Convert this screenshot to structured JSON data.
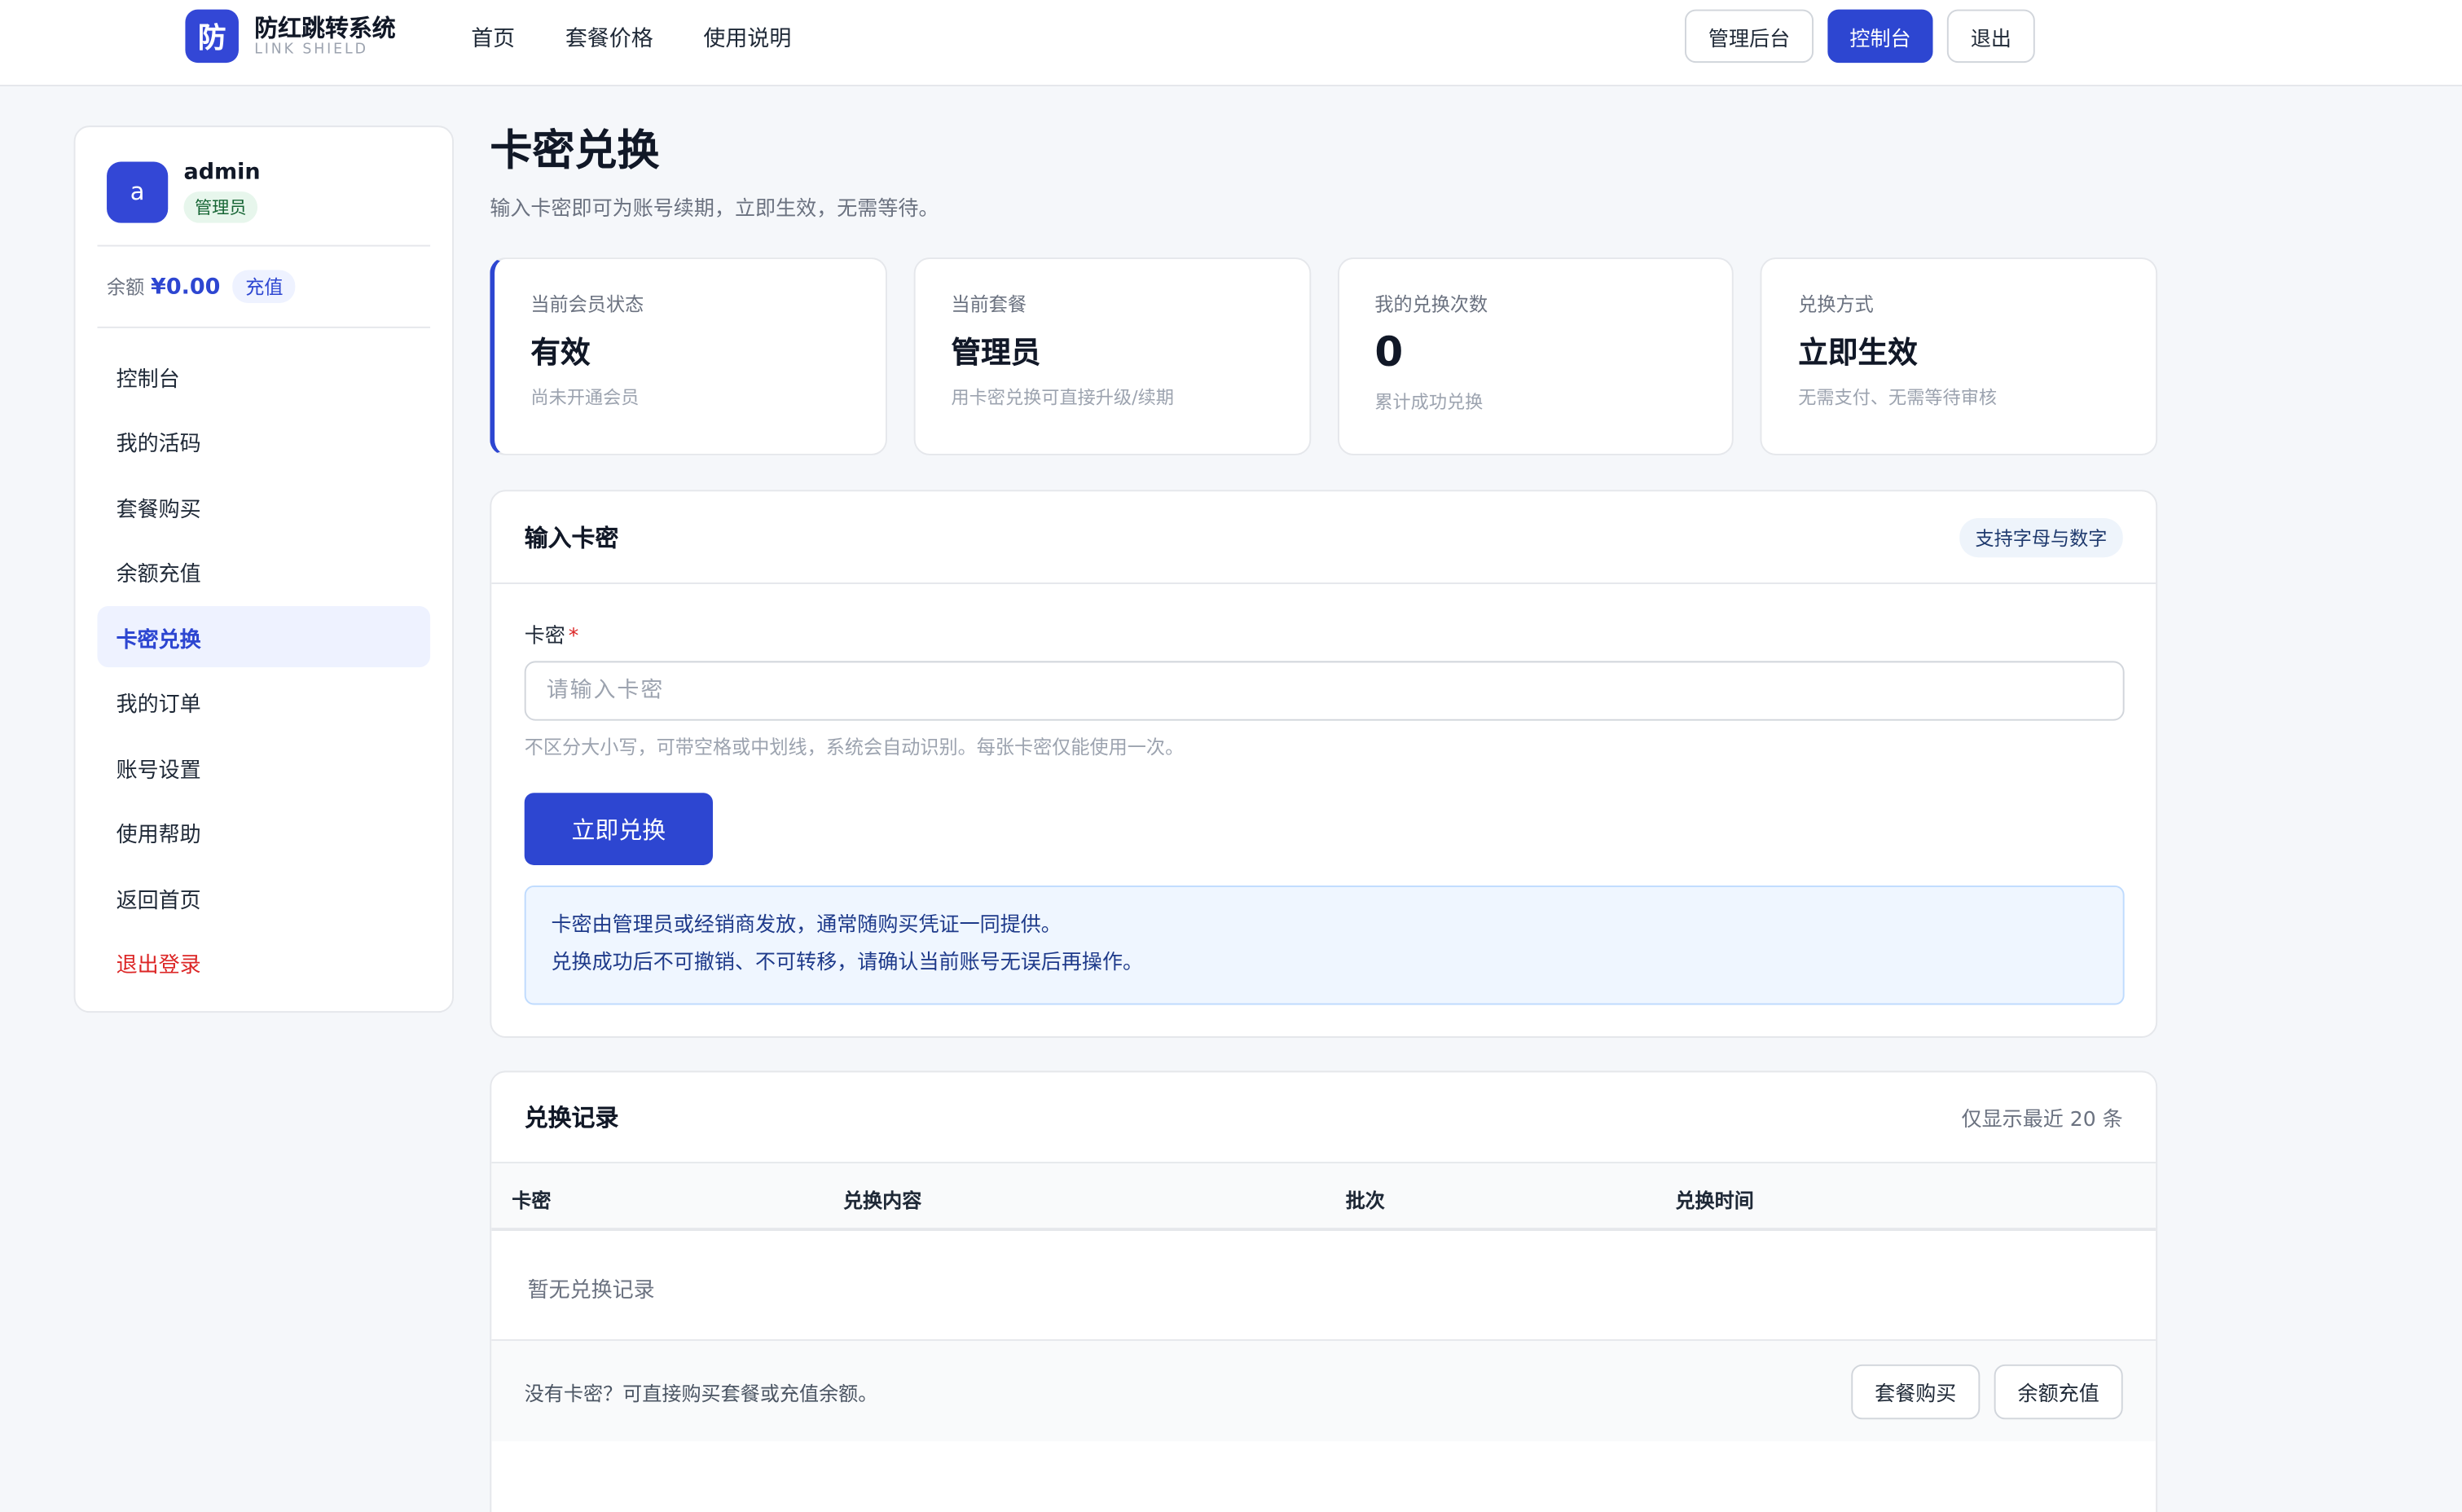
{
  "header": {
    "logo_char": "防",
    "brand_name": "防红跳转系统",
    "brand_sub": "LINK SHIELD",
    "nav": [
      "首页",
      "套餐价格",
      "使用说明"
    ],
    "actions": {
      "admin": "管理后台",
      "console": "控制台",
      "logout": "退出"
    }
  },
  "sidebar": {
    "user": {
      "avatar": "a",
      "name": "admin",
      "role": "管理员"
    },
    "balance": {
      "label": "余额",
      "amount": "¥0.00",
      "recharge": "充值"
    },
    "menu": [
      "控制台",
      "我的活码",
      "套餐购买",
      "余额充值",
      "卡密兑换",
      "我的订单",
      "账号设置",
      "使用帮助",
      "返回首页",
      "退出登录"
    ]
  },
  "page": {
    "title": "卡密兑换",
    "subtitle": "输入卡密即可为账号续期，立即生效，无需等待。"
  },
  "stats": [
    {
      "label": "当前会员状态",
      "value": "有效",
      "note": "尚未开通会员"
    },
    {
      "label": "当前套餐",
      "value": "管理员",
      "note": "用卡密兑换可直接升级/续期"
    },
    {
      "label": "我的兑换次数",
      "value": "0",
      "note": "累计成功兑换"
    },
    {
      "label": "兑换方式",
      "value": "立即生效",
      "note": "无需支付、无需等待审核"
    }
  ],
  "redeem": {
    "title": "输入卡密",
    "tag": "支持字母与数字",
    "field_label": "卡密",
    "required_mark": "*",
    "input": {
      "value": "",
      "placeholder": "请输入卡密"
    },
    "hint": "不区分大小写，可带空格或中划线，系统会自动识别。每张卡密仅能使用一次。",
    "submit": "立即兑换",
    "notice": [
      "卡密由管理员或经销商发放，通常随购买凭证一同提供。",
      "兑换成功后不可撤销、不可转移，请确认当前账号无误后再操作。"
    ]
  },
  "records": {
    "title": "兑换记录",
    "meta": "仅显示最近 20 条",
    "columns": [
      "卡密",
      "兑换内容",
      "批次",
      "兑换时间"
    ],
    "empty": "暂无兑换记录",
    "footer_text": "没有卡密？可直接购买套餐或充值余额。",
    "footer_buttons": [
      "套餐购买",
      "余额充值"
    ]
  }
}
